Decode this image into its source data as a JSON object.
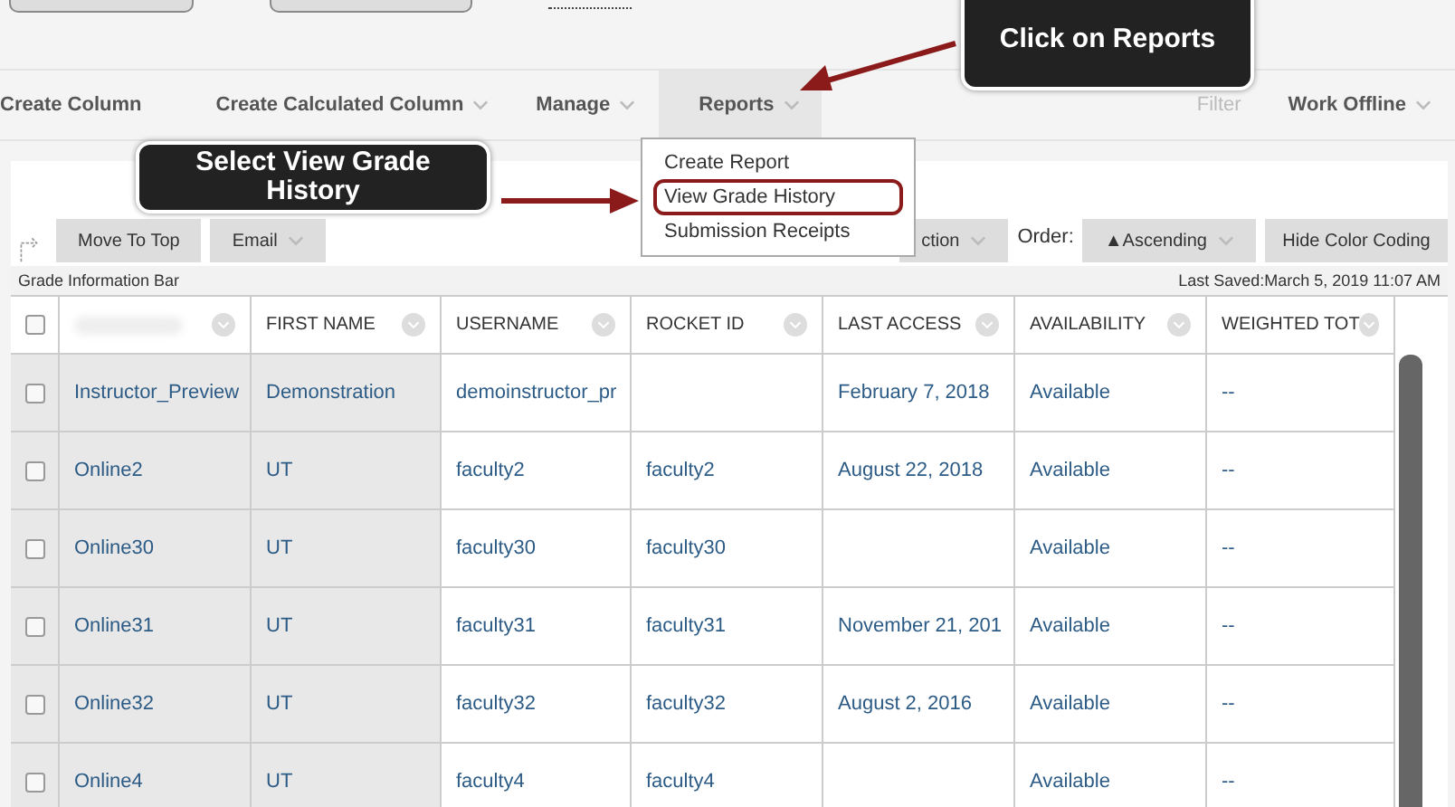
{
  "menu": {
    "left": [
      {
        "label": "Create Column",
        "caret": false,
        "selected": false
      },
      {
        "label": "Create Calculated Column",
        "caret": true,
        "selected": false
      },
      {
        "label": "Manage",
        "caret": true,
        "selected": false
      },
      {
        "label": "Reports",
        "caret": true,
        "selected": true
      }
    ],
    "right": [
      {
        "label": "Filter",
        "caret": false,
        "disabled": true
      },
      {
        "label": "Work Offline",
        "caret": true,
        "disabled": false
      }
    ]
  },
  "dropdown": [
    {
      "label": "Create Report",
      "highlighted": false
    },
    {
      "label": "View Grade History",
      "highlighted": true
    },
    {
      "label": "Submission Receipts",
      "highlighted": false
    }
  ],
  "callouts": [
    {
      "text": "Click on Reports"
    },
    {
      "text": "Select View Grade History"
    }
  ],
  "toolbar": {
    "left": [
      {
        "label": "Move To Top",
        "caret": false
      },
      {
        "label": "Email",
        "caret": true
      }
    ],
    "partial": {
      "label": "ction",
      "caret": true
    },
    "order_label": "Order:",
    "sort": {
      "label": "▲Ascending",
      "caret": true
    },
    "hide": {
      "label": "Hide Color Coding",
      "caret": false
    }
  },
  "info_bar": {
    "title": "Grade Information Bar",
    "saved": "Last Saved:March 5, 2019 11:07 AM"
  },
  "table": {
    "header_checked": false,
    "columns": [
      "",
      "FIRST NAME",
      "USERNAME",
      "ROCKET ID",
      "LAST ACCESS",
      "AVAILABILITY",
      "WEIGHTED TOT"
    ],
    "rows": [
      {
        "checked": false,
        "cells": [
          "Instructor_Preview",
          "Demonstration",
          "demoinstructor_pr",
          "",
          "February 7, 2018",
          "Available",
          "--"
        ]
      },
      {
        "checked": false,
        "cells": [
          "Online2",
          "UT",
          "faculty2",
          "faculty2",
          "August 22, 2018",
          "Available",
          "--"
        ]
      },
      {
        "checked": false,
        "cells": [
          "Online30",
          "UT",
          "faculty30",
          "faculty30",
          "",
          "Available",
          "--"
        ]
      },
      {
        "checked": false,
        "cells": [
          "Online31",
          "UT",
          "faculty31",
          "faculty31",
          "November 21, 201",
          "Available",
          "--"
        ]
      },
      {
        "checked": false,
        "cells": [
          "Online32",
          "UT",
          "faculty32",
          "faculty32",
          "August 2, 2016",
          "Available",
          "--"
        ]
      },
      {
        "checked": false,
        "cells": [
          "Online4",
          "UT",
          "faculty4",
          "faculty4",
          "",
          "Available",
          "--"
        ]
      }
    ]
  }
}
